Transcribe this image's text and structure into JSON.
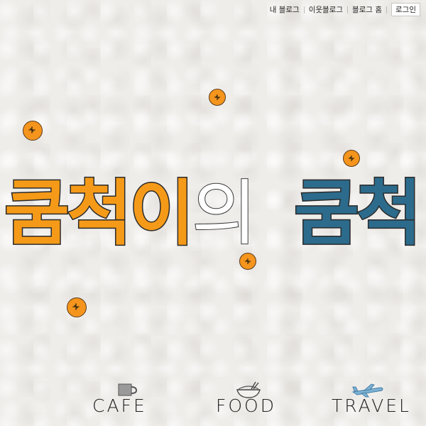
{
  "topnav": {
    "my_blog": "내 블로그",
    "neighbor_blog": "이웃블로그",
    "blog_home": "블로그 홈",
    "login": "로그인"
  },
  "title": {
    "part1": "쿰척이",
    "part2": "의",
    "part3": "쿰척"
  },
  "menu": {
    "cafe": "CAFE",
    "food": "FOOD",
    "travel": "TRAVEL"
  },
  "colors": {
    "orange": "#f59a18",
    "blue": "#2c6b8c",
    "background": "#efedea"
  },
  "icons": {
    "cafe": "coffee-cup-icon",
    "food": "rice-bowl-icon",
    "travel": "airplane-icon",
    "decoration": "orange-coin-icon"
  }
}
